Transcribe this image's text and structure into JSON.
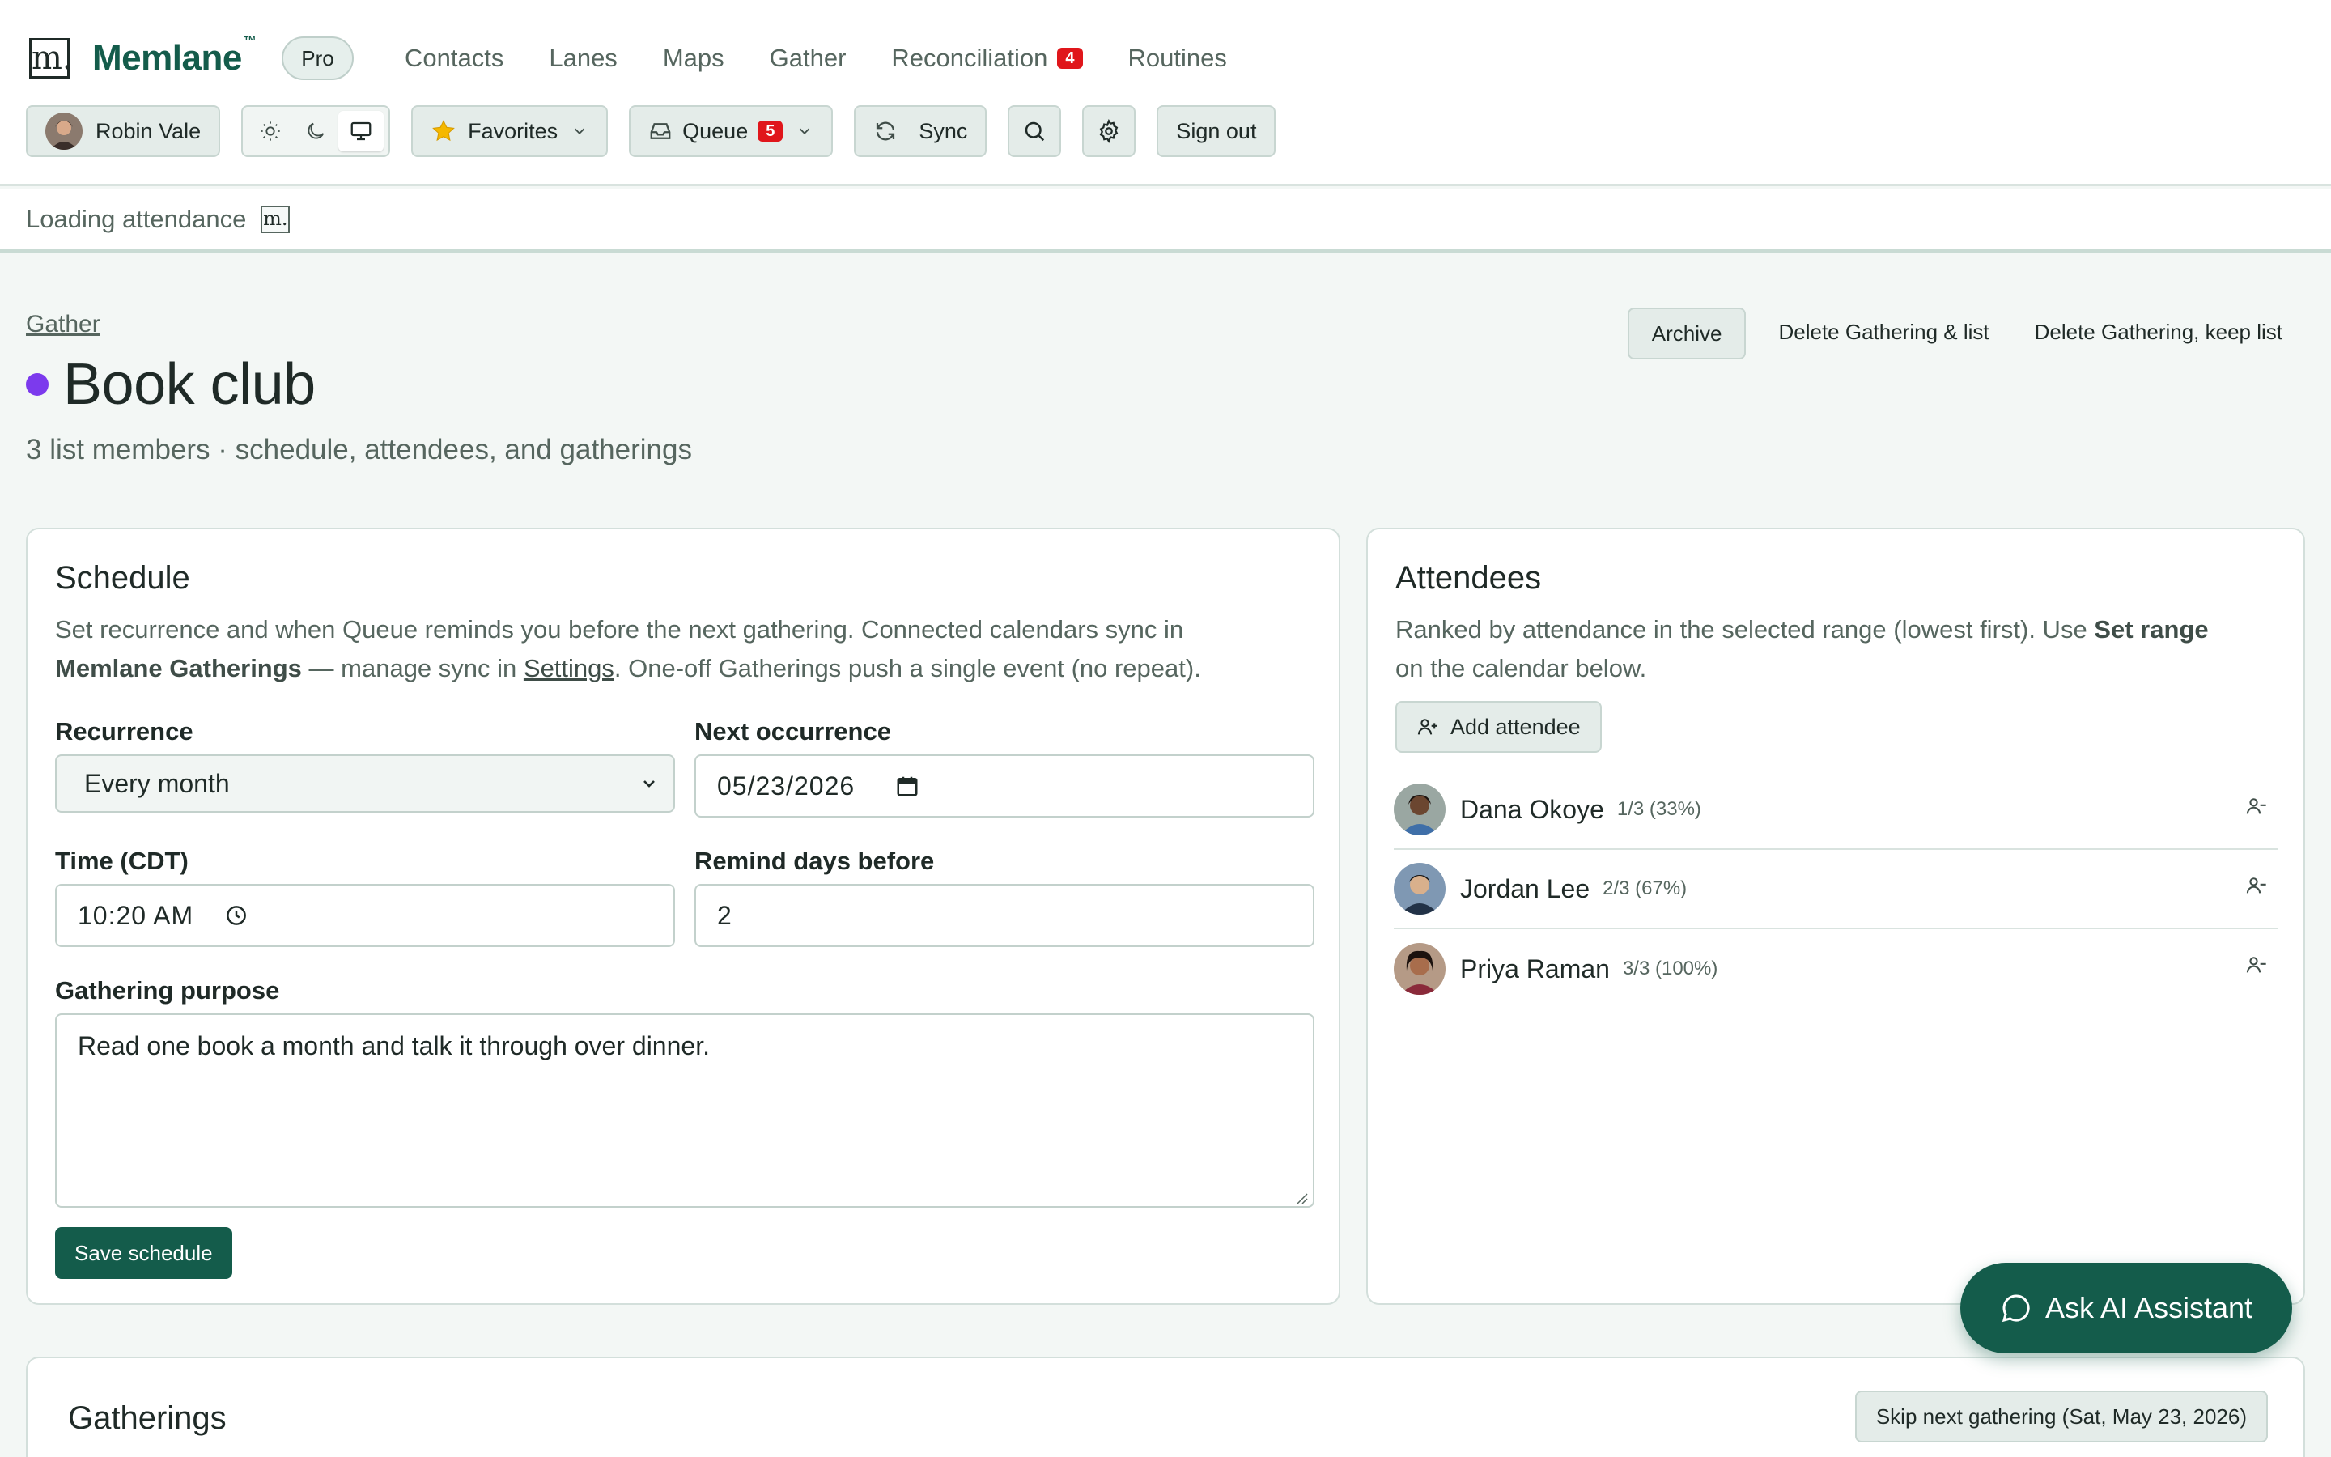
{
  "brand": {
    "logo_letter": "m.",
    "name": "Memlane",
    "tm": "™",
    "plan": "Pro"
  },
  "nav": {
    "contacts": "Contacts",
    "lanes": "Lanes",
    "maps": "Maps",
    "gather": "Gather",
    "reconciliation": "Reconciliation",
    "reconciliation_count": "4",
    "routines": "Routines"
  },
  "toolbar": {
    "user_name": "Robin Vale",
    "favorites": "Favorites",
    "queue": "Queue",
    "queue_count": "5",
    "sync": "Sync",
    "sign_out": "Sign out"
  },
  "loading": {
    "text": "Loading attendance",
    "logo_letter": "m."
  },
  "page": {
    "breadcrumb": "Gather",
    "title": "Book club",
    "title_dot_color": "#7c3aed",
    "subtitle": "3 list members · schedule, attendees, and gatherings",
    "actions": {
      "archive": "Archive",
      "delete_all": "Delete Gathering & list",
      "delete_keep": "Delete Gathering, keep list"
    }
  },
  "schedule": {
    "title": "Schedule",
    "desc_1": "Set recurrence and when Queue reminds you before the next gathering. Connected calendars sync in",
    "desc_bold": "Memlane Gatherings",
    "desc_2": " — manage sync in ",
    "desc_link": "Settings",
    "desc_3": ". One-off Gatherings push a single event (no repeat).",
    "recurrence_label": "Recurrence",
    "recurrence_value": "Every month",
    "next_label": "Next occurrence",
    "next_value": "05/23/2026",
    "time_label": "Time (CDT)",
    "time_value": "10:20 AM",
    "remind_label": "Remind days before",
    "remind_value": "2",
    "purpose_label": "Gathering purpose",
    "purpose_value": "Read one book a month and talk it through over dinner.",
    "save": "Save schedule"
  },
  "attendees": {
    "title": "Attendees",
    "desc_1": "Ranked by attendance in the selected range (lowest first). Use ",
    "desc_bold": "Set range",
    "desc_2": "on the calendar below.",
    "add": "Add attendee",
    "list": [
      {
        "name": "Dana Okoye",
        "stat": "1/3 (33%)"
      },
      {
        "name": "Jordan Lee",
        "stat": "2/3 (67%)"
      },
      {
        "name": "Priya Raman",
        "stat": "3/3 (100%)"
      }
    ]
  },
  "gatherings": {
    "title": "Gatherings",
    "skip": "Skip next gathering (Sat, May 23, 2026)"
  },
  "assistant": {
    "label": "Ask AI Assistant"
  },
  "colors": {
    "brand": "#145c4b",
    "badge": "#e0161b"
  }
}
